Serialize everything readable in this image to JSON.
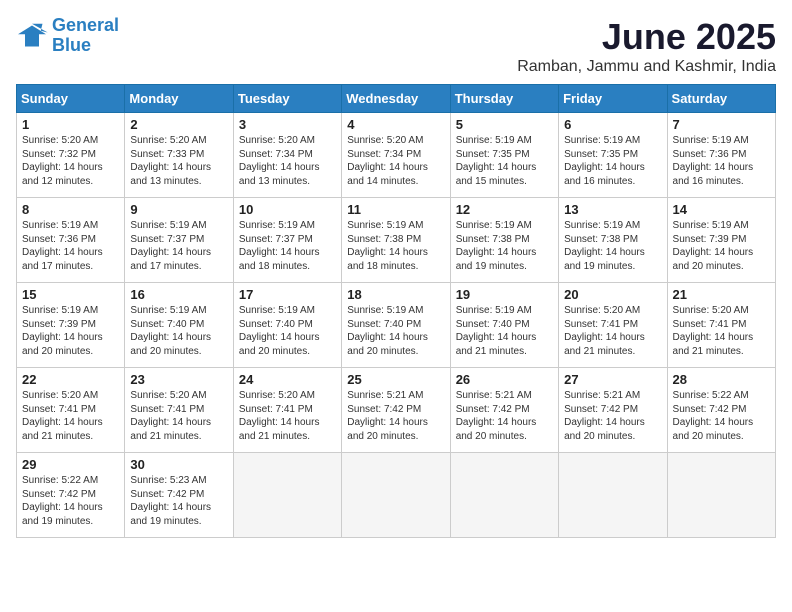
{
  "header": {
    "logo_line1": "General",
    "logo_line2": "Blue",
    "month": "June 2025",
    "location": "Ramban, Jammu and Kashmir, India"
  },
  "days_of_week": [
    "Sunday",
    "Monday",
    "Tuesday",
    "Wednesday",
    "Thursday",
    "Friday",
    "Saturday"
  ],
  "weeks": [
    [
      {
        "day": 1,
        "lines": [
          "Sunrise: 5:20 AM",
          "Sunset: 7:32 PM",
          "Daylight: 14 hours",
          "and 12 minutes."
        ]
      },
      {
        "day": 2,
        "lines": [
          "Sunrise: 5:20 AM",
          "Sunset: 7:33 PM",
          "Daylight: 14 hours",
          "and 13 minutes."
        ]
      },
      {
        "day": 3,
        "lines": [
          "Sunrise: 5:20 AM",
          "Sunset: 7:34 PM",
          "Daylight: 14 hours",
          "and 13 minutes."
        ]
      },
      {
        "day": 4,
        "lines": [
          "Sunrise: 5:20 AM",
          "Sunset: 7:34 PM",
          "Daylight: 14 hours",
          "and 14 minutes."
        ]
      },
      {
        "day": 5,
        "lines": [
          "Sunrise: 5:19 AM",
          "Sunset: 7:35 PM",
          "Daylight: 14 hours",
          "and 15 minutes."
        ]
      },
      {
        "day": 6,
        "lines": [
          "Sunrise: 5:19 AM",
          "Sunset: 7:35 PM",
          "Daylight: 14 hours",
          "and 16 minutes."
        ]
      },
      {
        "day": 7,
        "lines": [
          "Sunrise: 5:19 AM",
          "Sunset: 7:36 PM",
          "Daylight: 14 hours",
          "and 16 minutes."
        ]
      }
    ],
    [
      {
        "day": 8,
        "lines": [
          "Sunrise: 5:19 AM",
          "Sunset: 7:36 PM",
          "Daylight: 14 hours",
          "and 17 minutes."
        ]
      },
      {
        "day": 9,
        "lines": [
          "Sunrise: 5:19 AM",
          "Sunset: 7:37 PM",
          "Daylight: 14 hours",
          "and 17 minutes."
        ]
      },
      {
        "day": 10,
        "lines": [
          "Sunrise: 5:19 AM",
          "Sunset: 7:37 PM",
          "Daylight: 14 hours",
          "and 18 minutes."
        ]
      },
      {
        "day": 11,
        "lines": [
          "Sunrise: 5:19 AM",
          "Sunset: 7:38 PM",
          "Daylight: 14 hours",
          "and 18 minutes."
        ]
      },
      {
        "day": 12,
        "lines": [
          "Sunrise: 5:19 AM",
          "Sunset: 7:38 PM",
          "Daylight: 14 hours",
          "and 19 minutes."
        ]
      },
      {
        "day": 13,
        "lines": [
          "Sunrise: 5:19 AM",
          "Sunset: 7:38 PM",
          "Daylight: 14 hours",
          "and 19 minutes."
        ]
      },
      {
        "day": 14,
        "lines": [
          "Sunrise: 5:19 AM",
          "Sunset: 7:39 PM",
          "Daylight: 14 hours",
          "and 20 minutes."
        ]
      }
    ],
    [
      {
        "day": 15,
        "lines": [
          "Sunrise: 5:19 AM",
          "Sunset: 7:39 PM",
          "Daylight: 14 hours",
          "and 20 minutes."
        ]
      },
      {
        "day": 16,
        "lines": [
          "Sunrise: 5:19 AM",
          "Sunset: 7:40 PM",
          "Daylight: 14 hours",
          "and 20 minutes."
        ]
      },
      {
        "day": 17,
        "lines": [
          "Sunrise: 5:19 AM",
          "Sunset: 7:40 PM",
          "Daylight: 14 hours",
          "and 20 minutes."
        ]
      },
      {
        "day": 18,
        "lines": [
          "Sunrise: 5:19 AM",
          "Sunset: 7:40 PM",
          "Daylight: 14 hours",
          "and 20 minutes."
        ]
      },
      {
        "day": 19,
        "lines": [
          "Sunrise: 5:19 AM",
          "Sunset: 7:40 PM",
          "Daylight: 14 hours",
          "and 21 minutes."
        ]
      },
      {
        "day": 20,
        "lines": [
          "Sunrise: 5:20 AM",
          "Sunset: 7:41 PM",
          "Daylight: 14 hours",
          "and 21 minutes."
        ]
      },
      {
        "day": 21,
        "lines": [
          "Sunrise: 5:20 AM",
          "Sunset: 7:41 PM",
          "Daylight: 14 hours",
          "and 21 minutes."
        ]
      }
    ],
    [
      {
        "day": 22,
        "lines": [
          "Sunrise: 5:20 AM",
          "Sunset: 7:41 PM",
          "Daylight: 14 hours",
          "and 21 minutes."
        ]
      },
      {
        "day": 23,
        "lines": [
          "Sunrise: 5:20 AM",
          "Sunset: 7:41 PM",
          "Daylight: 14 hours",
          "and 21 minutes."
        ]
      },
      {
        "day": 24,
        "lines": [
          "Sunrise: 5:20 AM",
          "Sunset: 7:41 PM",
          "Daylight: 14 hours",
          "and 21 minutes."
        ]
      },
      {
        "day": 25,
        "lines": [
          "Sunrise: 5:21 AM",
          "Sunset: 7:42 PM",
          "Daylight: 14 hours",
          "and 20 minutes."
        ]
      },
      {
        "day": 26,
        "lines": [
          "Sunrise: 5:21 AM",
          "Sunset: 7:42 PM",
          "Daylight: 14 hours",
          "and 20 minutes."
        ]
      },
      {
        "day": 27,
        "lines": [
          "Sunrise: 5:21 AM",
          "Sunset: 7:42 PM",
          "Daylight: 14 hours",
          "and 20 minutes."
        ]
      },
      {
        "day": 28,
        "lines": [
          "Sunrise: 5:22 AM",
          "Sunset: 7:42 PM",
          "Daylight: 14 hours",
          "and 20 minutes."
        ]
      }
    ],
    [
      {
        "day": 29,
        "lines": [
          "Sunrise: 5:22 AM",
          "Sunset: 7:42 PM",
          "Daylight: 14 hours",
          "and 19 minutes."
        ]
      },
      {
        "day": 30,
        "lines": [
          "Sunrise: 5:23 AM",
          "Sunset: 7:42 PM",
          "Daylight: 14 hours",
          "and 19 minutes."
        ]
      },
      null,
      null,
      null,
      null,
      null
    ]
  ]
}
